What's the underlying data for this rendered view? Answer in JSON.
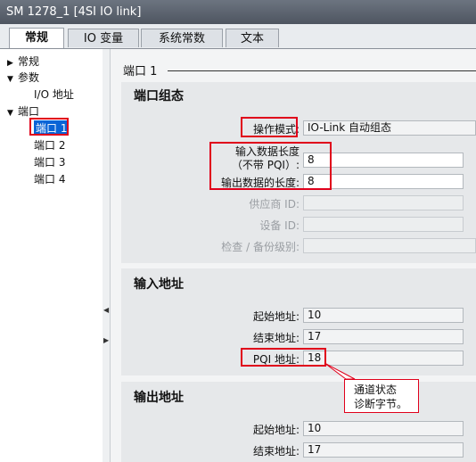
{
  "window": {
    "title": "SM 1278_1 [4SI IO link]"
  },
  "tabs": [
    {
      "label": "常规"
    },
    {
      "label": "IO 变量"
    },
    {
      "label": "系统常数"
    },
    {
      "label": "文本"
    }
  ],
  "tree": {
    "general": "常规",
    "params": "参数",
    "io_address": "I/O 地址",
    "port": "端口",
    "port1": "端口 1",
    "port2": "端口 2",
    "port3": "端口 3",
    "port4": "端口 4"
  },
  "content": {
    "heading": "端口 1",
    "port_config": {
      "title": "端口组态",
      "op_mode_label": "操作模式:",
      "op_mode_value": "IO-Link 自动组态",
      "input_len_label_1": "输入数据长度",
      "input_len_label_2": "（不带 PQI）:",
      "input_len_value": "8",
      "output_len_label": "输出数据的长度:",
      "output_len_value": "8",
      "vendor_label": "供应商 ID:",
      "device_label": "设备 ID:",
      "backup_label": "检查 / 备份级别:"
    },
    "input_addr": {
      "title": "输入地址",
      "start_label": "起始地址:",
      "start_value": "10",
      "end_label": "结束地址:",
      "end_value": "17",
      "pqi_label": "PQI 地址:",
      "pqi_value": "18"
    },
    "output_addr": {
      "title": "输出地址",
      "start_label": "起始地址:",
      "start_value": "10",
      "end_label": "结束地址:",
      "end_value": "17"
    },
    "callout": {
      "line1": "通道状态",
      "line2": "诊断字节。"
    }
  },
  "colors": {
    "highlight": "#e0001b",
    "title_bar": "#5a616b"
  }
}
